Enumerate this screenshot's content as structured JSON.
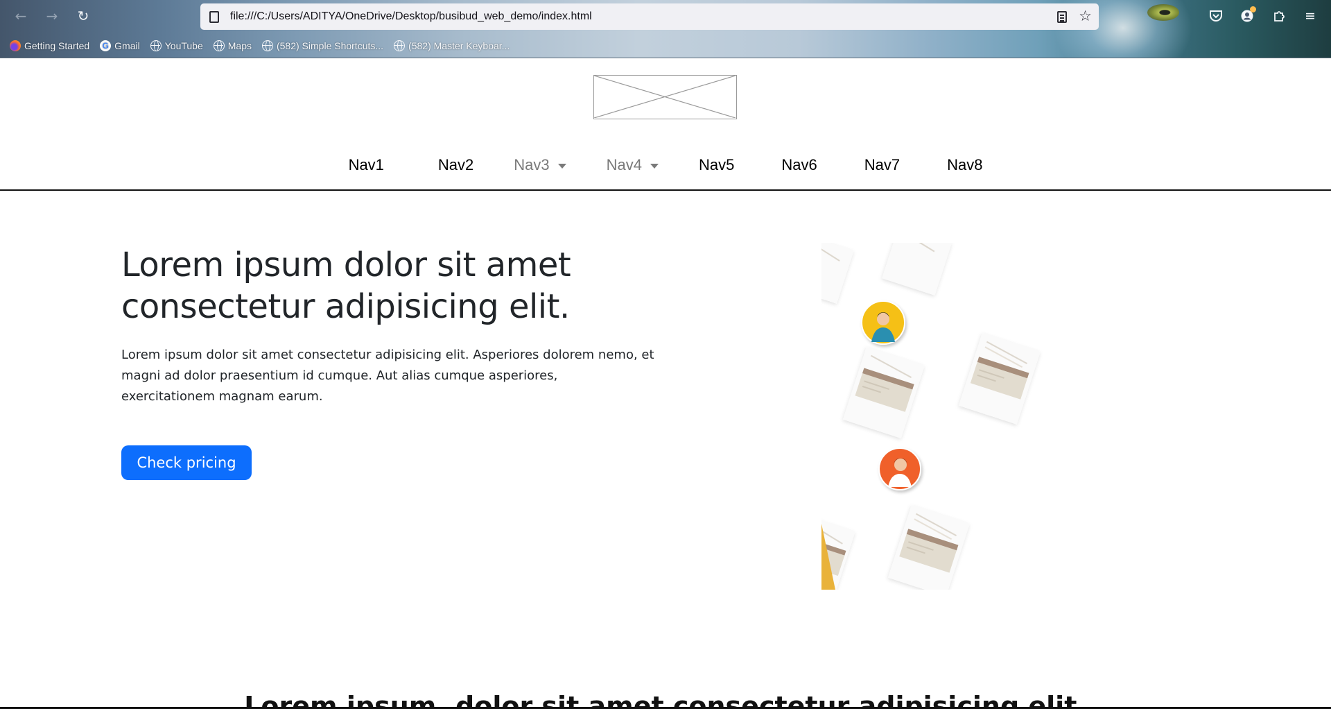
{
  "browser": {
    "url": "file:///C:/Users/ADITYA/OneDrive/Desktop/busibud_web_demo/index.html",
    "bookmarks": [
      {
        "label": "Getting Started",
        "icon": "firefox-icon"
      },
      {
        "label": "Gmail",
        "icon": "google-icon"
      },
      {
        "label": "YouTube",
        "icon": "globe-icon"
      },
      {
        "label": "Maps",
        "icon": "globe-icon"
      },
      {
        "label": "(582) Simple Shortcuts...",
        "icon": "globe-icon"
      },
      {
        "label": "(582) Master Keyboar...",
        "icon": "globe-icon"
      }
    ],
    "google_icon_letter": "G"
  },
  "nav": {
    "items": [
      {
        "label": "Nav1",
        "dropdown": false
      },
      {
        "label": "Nav2",
        "dropdown": false
      },
      {
        "label": "Nav3",
        "dropdown": true
      },
      {
        "label": "Nav4",
        "dropdown": true
      },
      {
        "label": "Nav5",
        "dropdown": false
      },
      {
        "label": "Nav6",
        "dropdown": false
      },
      {
        "label": "Nav7",
        "dropdown": false
      },
      {
        "label": "Nav8",
        "dropdown": false
      }
    ]
  },
  "hero": {
    "title_line1": "Lorem ipsum dolor sit amet",
    "title_line2": "consectetur adipisicing elit.",
    "text": "Lorem ipsum dolor sit amet consectetur adipisicing elit. Asperiores dolorem nemo, et magni ad dolor praesentium id cumque. Aut alias cumque asperiores, exercitationem magnam earum.",
    "button_label": "Check pricing"
  },
  "section": {
    "heading": "Lorem ipsum, dolor sit amet consectetur adipisicing elit."
  },
  "colors": {
    "primary_button": "#0d6efd",
    "text": "#212529",
    "avatar_yellow": "#f5c013",
    "avatar_orange": "#f0612a"
  }
}
